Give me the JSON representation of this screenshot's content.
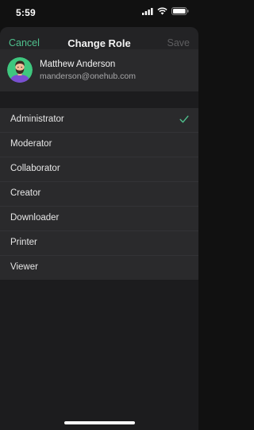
{
  "status_bar": {
    "time": "5:59",
    "signal_icon": "cellular-signal-icon",
    "wifi_icon": "wifi-icon",
    "battery_icon": "battery-icon"
  },
  "nav": {
    "cancel_label": "Cancel",
    "title": "Change Role",
    "save_label": "Save",
    "accent_color": "#4fc08d",
    "disabled_color": "#5e5e60"
  },
  "user": {
    "name": "Matthew Anderson",
    "email": "manderson@onehub.com",
    "avatar_icon": "user-avatar-illustration",
    "avatar_bg_color": "#3fc77f"
  },
  "roles": {
    "items": [
      {
        "label": "Administrator",
        "selected": true
      },
      {
        "label": "Moderator",
        "selected": false
      },
      {
        "label": "Collaborator",
        "selected": false
      },
      {
        "label": "Creator",
        "selected": false
      },
      {
        "label": "Downloader",
        "selected": false
      },
      {
        "label": "Printer",
        "selected": false
      },
      {
        "label": "Viewer",
        "selected": false
      }
    ],
    "check_icon": "checkmark-icon"
  }
}
